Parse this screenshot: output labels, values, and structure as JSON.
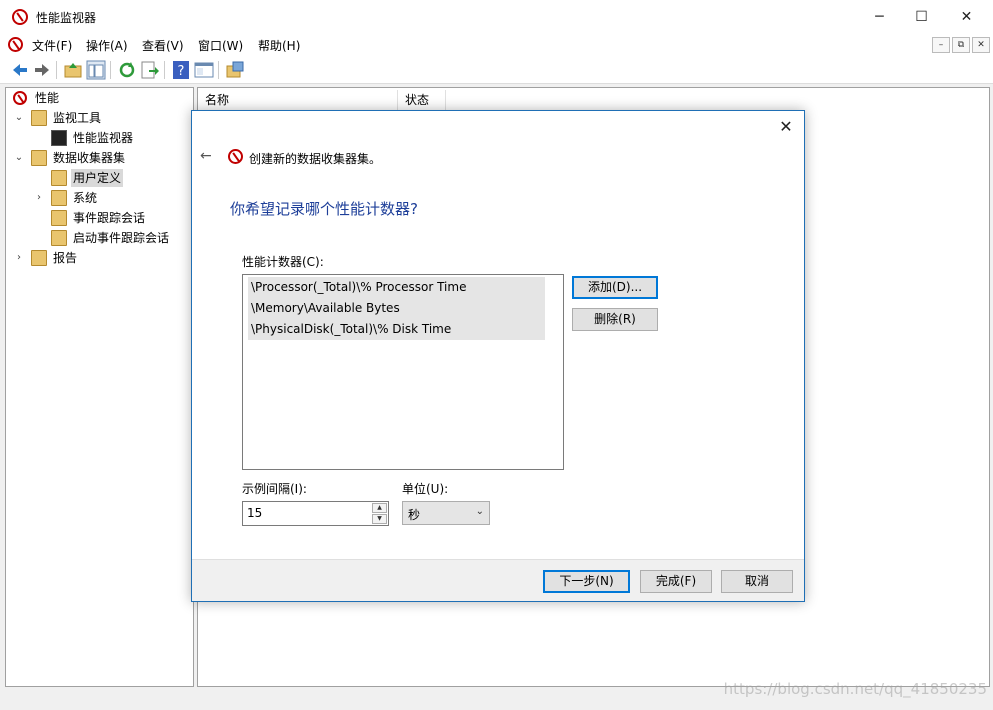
{
  "window": {
    "title": "性能监视器",
    "controls": {
      "minimize": "─",
      "maximize": "☐",
      "close": "✕"
    }
  },
  "menubar": {
    "items": [
      "文件(F)",
      "操作(A)",
      "查看(V)",
      "窗口(W)",
      "帮助(H)"
    ],
    "mdi_controls": [
      "–",
      "⧉",
      "✕"
    ]
  },
  "toolbar": {
    "icons": [
      "back-arrow-icon",
      "forward-arrow-icon",
      "up-folder-icon",
      "show-hide-tree-icon",
      "refresh-icon",
      "export-list-icon",
      "help-icon",
      "properties-icon",
      "new-collector-icon"
    ]
  },
  "tree": {
    "items": [
      {
        "label": "性能",
        "icon": "performance-icon"
      },
      {
        "label": "监视工具",
        "icon": "folder-icon",
        "expanded": true
      },
      {
        "label": "性能监视器",
        "icon": "monitor-chart-icon"
      },
      {
        "label": "数据收集器集",
        "icon": "folder-icon",
        "expanded": true
      },
      {
        "label": "用户定义",
        "icon": "user-folder-icon",
        "selected": true
      },
      {
        "label": "系统",
        "icon": "folder-icon",
        "expanded": false
      },
      {
        "label": "事件跟踪会话",
        "icon": "doc-folder-icon"
      },
      {
        "label": "启动事件跟踪会话",
        "icon": "doc-folder-icon"
      },
      {
        "label": "报告",
        "icon": "report-folder-icon",
        "expanded": false
      }
    ]
  },
  "list": {
    "columns": [
      "名称",
      "状态"
    ]
  },
  "dialog": {
    "subtitle": "创建新的数据收集器集。",
    "heading": "你希望记录哪个性能计数器?",
    "counters_label": "性能计数器(C):",
    "counters": [
      "\\Processor(_Total)\\% Processor Time",
      "\\Memory\\Available Bytes",
      "\\PhysicalDisk(_Total)\\% Disk Time"
    ],
    "add_button": "添加(D)...",
    "remove_button": "删除(R)",
    "interval_label": "示例间隔(I):",
    "interval_value": "15",
    "unit_label": "单位(U):",
    "unit_value": "秒",
    "next_button": "下一步(N)",
    "finish_button": "完成(F)",
    "cancel_button": "取消",
    "close": "✕",
    "back": "←"
  },
  "watermark": "https://blog.csdn.net/qq_41850235",
  "colors": {
    "accent": "#0078d7",
    "heading": "#1e3f99",
    "dialog_border": "#1f6fb5"
  }
}
